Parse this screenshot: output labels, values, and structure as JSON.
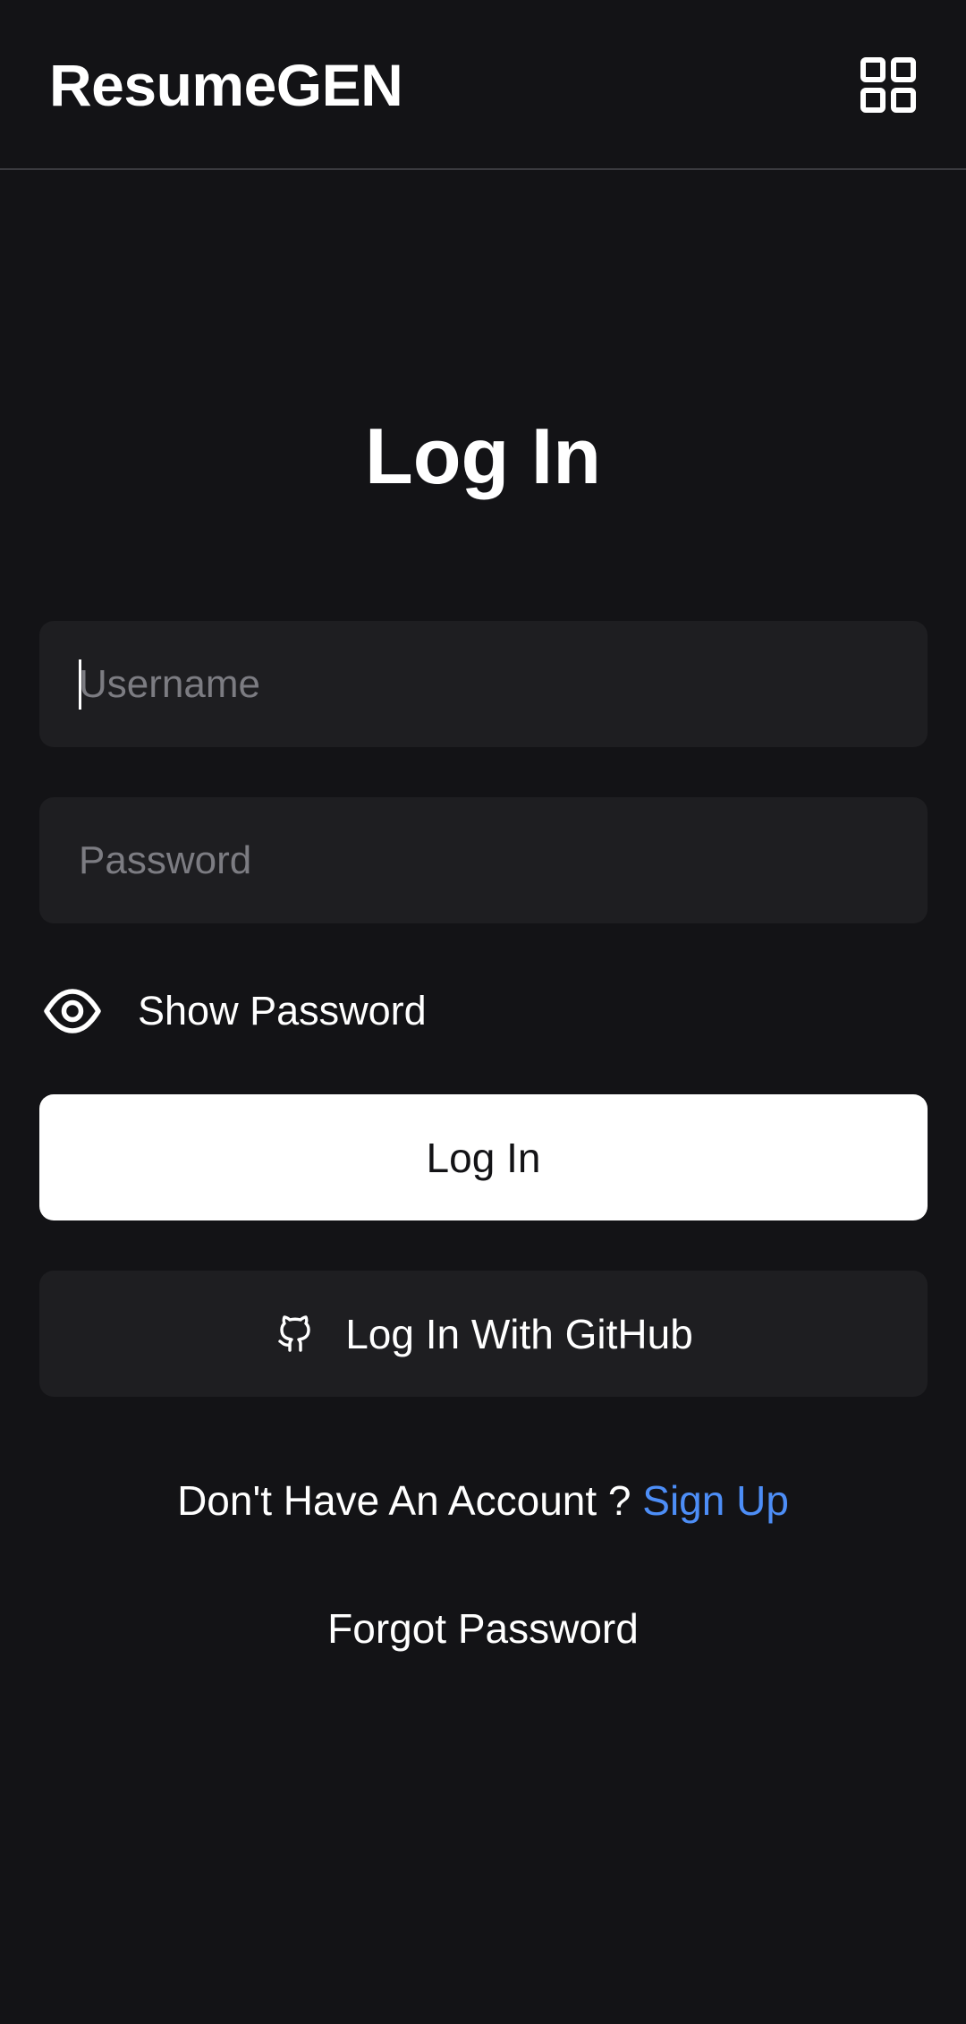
{
  "header": {
    "brand": "ResumeGEN",
    "menu_icon": "grid-icon"
  },
  "login": {
    "title": "Log In",
    "username_placeholder": "Username",
    "password_placeholder": "Password",
    "show_password_label": "Show Password",
    "show_password_icon": "eye-icon",
    "login_button": "Log In",
    "github_button": "Log In With GitHub",
    "github_icon": "github-icon",
    "no_account_text": "Don't Have An Account ?",
    "signup_link": "Sign Up",
    "forgot_password": "Forgot Password"
  },
  "colors": {
    "background": "#131316",
    "field_background": "#1e1e21",
    "link": "#4d8ef7",
    "primary_button": "#ffffff"
  }
}
